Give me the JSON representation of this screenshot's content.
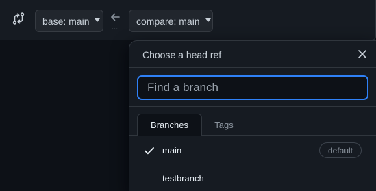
{
  "toolbar": {
    "compare_icon": "git-compare-icon",
    "base_label": "base: main",
    "arrow_icon": "arrow-left-icon",
    "dots": "...",
    "compare_label": "compare: main"
  },
  "dropdown": {
    "title": "Choose a head ref",
    "close_icon": "x-icon",
    "filter_placeholder": "Find a branch",
    "filter_value": "",
    "tabs": [
      {
        "label": "Branches",
        "selected": true
      },
      {
        "label": "Tags",
        "selected": false
      }
    ],
    "items": [
      {
        "name": "main",
        "checked": true,
        "badge": "default"
      },
      {
        "name": "testbranch",
        "checked": false,
        "badge": ""
      }
    ]
  },
  "colors": {
    "background": "#0d1117",
    "panel": "#161b22",
    "border": "#30363d",
    "focus": "#2f81f7",
    "text": "#e6edf3",
    "muted": "#8b949e"
  }
}
